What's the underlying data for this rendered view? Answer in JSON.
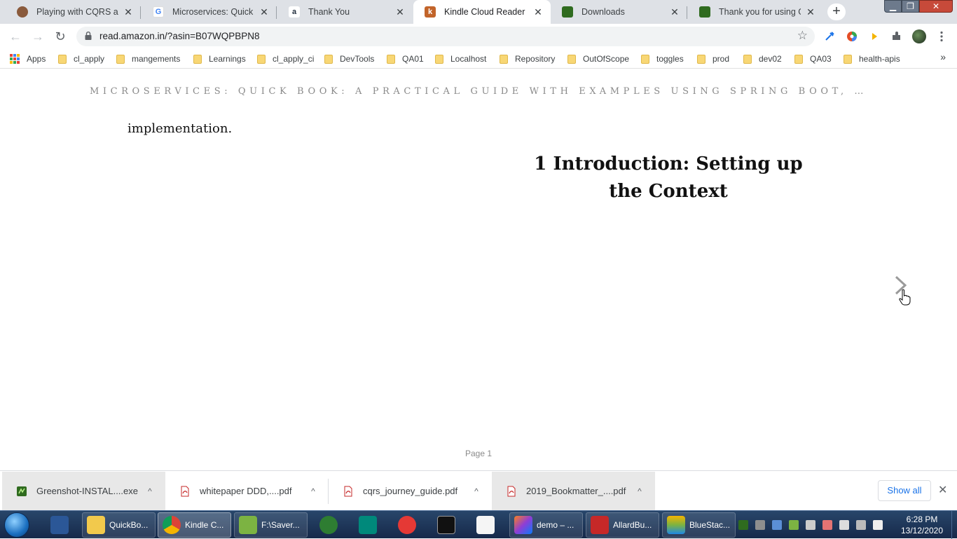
{
  "window": {
    "minimize_icon": "minimize-icon",
    "maximize_icon": "maximize-icon",
    "close_icon": "close-icon",
    "min_glyph": "▁",
    "max_glyph": "❐",
    "close_glyph": "✕"
  },
  "tabs": [
    {
      "title": "Playing with CQRS and E",
      "favicon": "profile-avatar",
      "color": "#8a5a3c",
      "active": false
    },
    {
      "title": "Microservices: Quick Boo",
      "favicon": "google-g",
      "color": "#4285f4",
      "active": false
    },
    {
      "title": "Thank You",
      "favicon": "amazon-a",
      "color": "#232f3e",
      "active": false
    },
    {
      "title": "Kindle Cloud Reader",
      "favicon": "kindle-k",
      "color": "#c2642a",
      "active": true
    },
    {
      "title": "Downloads",
      "favicon": "greenshot",
      "color": "#2f6b1f",
      "active": false
    },
    {
      "title": "Thank you for using Gre",
      "favicon": "greenshot",
      "color": "#2f6b1f",
      "active": false
    }
  ],
  "tab_close_glyph": "✕",
  "new_tab_glyph": "+",
  "toolbar": {
    "back_glyph": "←",
    "forward_glyph": "→",
    "reload_glyph": "↻",
    "url": "read.amazon.in/?asin=B07WQPBPN8",
    "star_glyph": "☆",
    "extensions": [
      {
        "name": "eyedropper-extension-icon",
        "color": "#1a73e8"
      },
      {
        "name": "color-wheel-extension-icon",
        "color": "#e44d26"
      },
      {
        "name": "arrow-extension-icon",
        "color": "#f4b400"
      },
      {
        "name": "puzzle-extensions-icon",
        "color": "#5f6368"
      },
      {
        "name": "profile-avatar-icon",
        "color": "#2d3a2d"
      },
      {
        "name": "menu-kebab-icon",
        "color": "#5f6368"
      }
    ]
  },
  "bookmarks": {
    "apps_label": "Apps",
    "items": [
      "cl_apply",
      "mangements",
      "Learnings",
      "cl_apply_ci",
      "DevTools",
      "QA01",
      "Localhost",
      "Repository",
      "OutOfScope",
      "toggles",
      "prod",
      "dev02",
      "QA03",
      "health-apis"
    ],
    "more_glyph": "»"
  },
  "reader": {
    "book_title": "MICROSERVICES: QUICK BOOK: A PRACTICAL GUIDE WITH EXAMPLES USING SPRING BOOT, …",
    "body_text": "implementation.",
    "chapter_line1": "1 Introduction: Setting up",
    "chapter_line2": "the Context",
    "page_indicator": "Page 1"
  },
  "downloads": {
    "items": [
      {
        "name": "Greenshot-INSTAL....exe",
        "type": "exe"
      },
      {
        "name": "whitepaper DDD,....pdf",
        "type": "pdf"
      },
      {
        "name": "cqrs_journey_guide.pdf",
        "type": "pdf"
      },
      {
        "name": "2019_Bookmatter_....pdf",
        "type": "pdf"
      }
    ],
    "caret_glyph": "^",
    "show_all": "Show all",
    "close_glyph": "✕"
  },
  "taskbar": {
    "items": [
      {
        "label": "",
        "icon": "word-icon",
        "color": "#2b5797",
        "width": "narrow"
      },
      {
        "label": "QuickBo...",
        "icon": "folder-icon",
        "color": "#f2c94c",
        "width": "wide"
      },
      {
        "label": "Kindle C...",
        "icon": "chrome-icon",
        "color": "#db4437",
        "width": "wide",
        "active": true
      },
      {
        "label": "F:\\Saver...",
        "icon": "notepad-plus-icon",
        "color": "#7cb342",
        "width": "wide"
      },
      {
        "label": "",
        "icon": "clock-app-icon",
        "color": "#2e7d32",
        "width": "narrow"
      },
      {
        "label": "",
        "icon": "editor-e-icon",
        "color": "#00897b",
        "width": "narrow"
      },
      {
        "label": "",
        "icon": "snipping-tool-icon",
        "color": "#e53935",
        "width": "narrow"
      },
      {
        "label": "",
        "icon": "cmd-icon",
        "color": "#111111",
        "width": "narrow"
      },
      {
        "label": "",
        "icon": "document-icon",
        "color": "#f5f5f5",
        "width": "narrow"
      },
      {
        "label": "demo – ...",
        "icon": "intellij-icon",
        "color": "#8e3dd6",
        "width": "wide"
      },
      {
        "label": "AllardBu...",
        "icon": "pdf-reader-icon",
        "color": "#c62828",
        "width": "wide"
      },
      {
        "label": "BlueStac...",
        "icon": "bluestacks-icon",
        "color": "#7cb342",
        "width": "wide"
      }
    ],
    "time": "6:28 PM",
    "date": "13/12/2020"
  }
}
